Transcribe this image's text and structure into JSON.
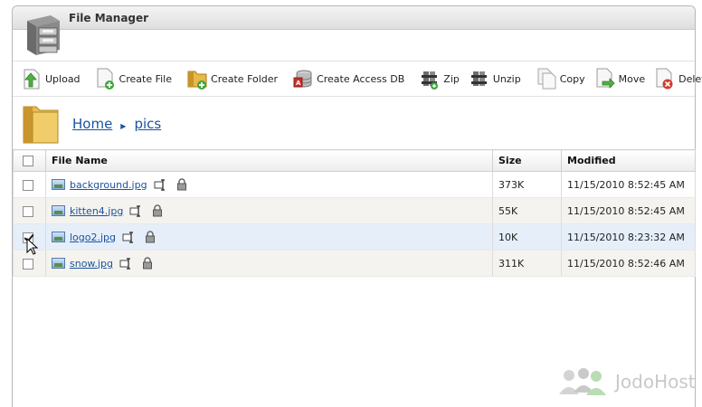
{
  "window": {
    "title": "File Manager"
  },
  "toolbar": {
    "buttons": [
      {
        "label": "Upload",
        "icon": "upload-icon"
      },
      {
        "label": "Create File",
        "icon": "create-file-icon"
      },
      {
        "label": "Create Folder",
        "icon": "create-folder-icon"
      },
      {
        "label": "Create Access DB",
        "icon": "database-icon"
      },
      {
        "label": "Zip",
        "icon": "zip-icon"
      },
      {
        "label": "Unzip",
        "icon": "unzip-icon"
      },
      {
        "label": "Copy",
        "icon": "copy-icon"
      },
      {
        "label": "Move",
        "icon": "move-icon"
      },
      {
        "label": "Delete",
        "icon": "delete-icon"
      }
    ]
  },
  "breadcrumb": {
    "home": "Home",
    "current": "pics"
  },
  "table": {
    "headers": {
      "name": "File Name",
      "size": "Size",
      "modified": "Modified"
    },
    "rows": [
      {
        "name": "background.jpg",
        "size": "373K",
        "modified": "11/15/2010 8:52:45 AM",
        "checked": false
      },
      {
        "name": "kitten4.jpg",
        "size": "55K",
        "modified": "11/15/2010 8:52:45 AM",
        "checked": false
      },
      {
        "name": "logo2.jpg",
        "size": "10K",
        "modified": "11/15/2010 8:23:32 AM",
        "checked": true
      },
      {
        "name": "snow.jpg",
        "size": "311K",
        "modified": "11/15/2010 8:52:46 AM",
        "checked": false
      }
    ]
  },
  "brand": {
    "name": "JodoHost"
  },
  "colors": {
    "link": "#1a53a0",
    "selected_row": "#e5eef9",
    "alt_row": "#f4f3ef"
  }
}
